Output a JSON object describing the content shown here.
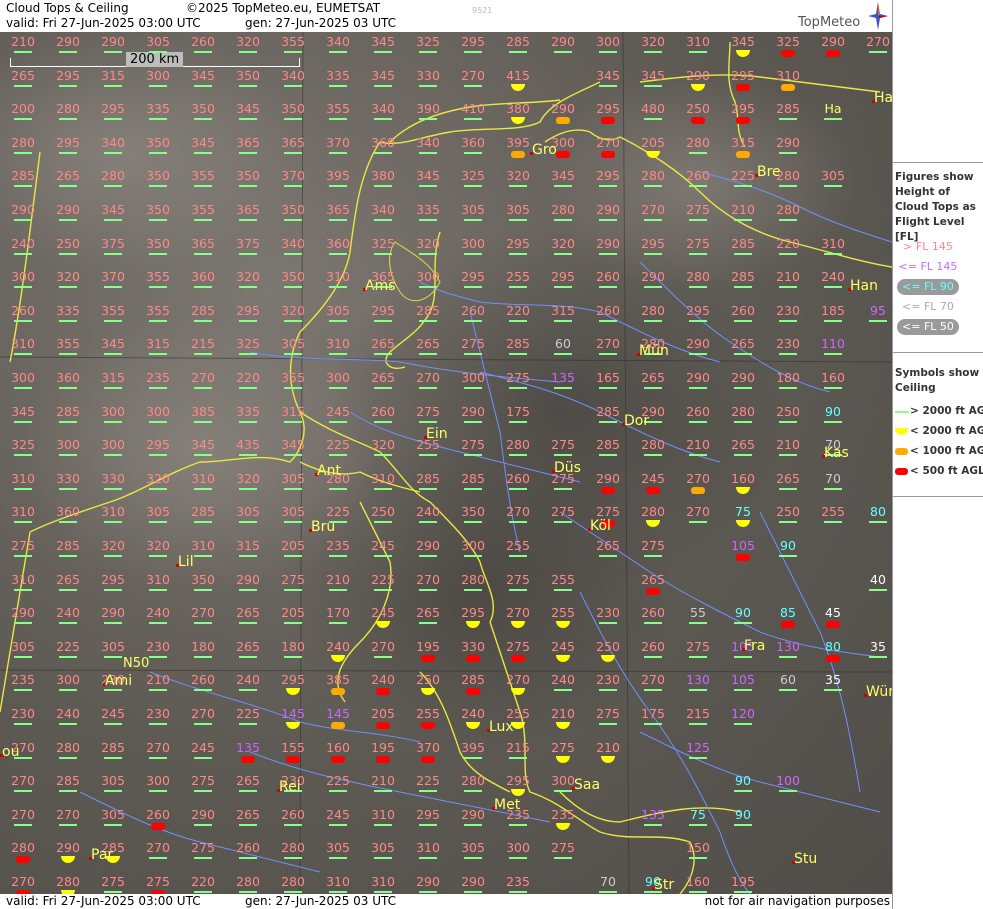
{
  "header": {
    "title": "Cloud Tops & Ceiling",
    "copyright": "©2025 TopMeteo.eu, EUMETSAT",
    "valid": "valid:  Fri  27-Jun-2025  03:00 UTC",
    "gen": "gen: 27-Jun-2025 03 UTC",
    "code": "9521",
    "logo": "TopMeteo"
  },
  "footer": {
    "valid": "valid:  Fri  27-Jun-2025  03:00 UTC",
    "gen": "gen: 27-Jun-2025 03 UTC",
    "note": "not for air navigation purposes"
  },
  "map": {
    "scale_label": "200 km",
    "latitude_label": "N50",
    "cities": [
      {
        "name": "Gro"
      },
      {
        "name": "Bre"
      },
      {
        "name": "Ams"
      },
      {
        "name": "Han"
      },
      {
        "name": "Mün"
      },
      {
        "name": "Dor"
      },
      {
        "name": "Ein"
      },
      {
        "name": "Ant"
      },
      {
        "name": "Düs"
      },
      {
        "name": "Kas"
      },
      {
        "name": "Köl"
      },
      {
        "name": "Bru"
      },
      {
        "name": "Lil"
      },
      {
        "name": "Fra"
      },
      {
        "name": "Ami"
      },
      {
        "name": "Wür"
      },
      {
        "name": "Lux"
      },
      {
        "name": "Rei"
      },
      {
        "name": "Saa"
      },
      {
        "name": "Met"
      },
      {
        "name": "Par"
      },
      {
        "name": "Stu"
      },
      {
        "name": "Str"
      },
      {
        "name": "Ha"
      },
      {
        "name": "ou"
      }
    ],
    "rows": [
      [
        "210",
        "290",
        "290",
        "305",
        "260",
        "320",
        "355",
        "340",
        "345",
        "325",
        "295",
        "285",
        "290",
        "300",
        "320",
        "310",
        "345",
        "325",
        "290",
        "270"
      ],
      [
        "265",
        "295",
        "315",
        "300",
        "345",
        "350",
        "340",
        "335",
        "345",
        "330",
        "270",
        "415",
        "",
        "345",
        "345",
        "290",
        "295",
        "310",
        ""
      ],
      [
        "200",
        "280",
        "295",
        "335",
        "350",
        "345",
        "350",
        "355",
        "340",
        "390",
        "410",
        "380",
        "290",
        "295",
        "480",
        "250",
        "295",
        "285",
        "Ha"
      ],
      [
        "280",
        "295",
        "340",
        "350",
        "345",
        "365",
        "365",
        "370",
        "360",
        "340",
        "360",
        "395",
        "300",
        "270",
        "205",
        "280",
        "315",
        "290",
        ""
      ],
      [
        "285",
        "265",
        "280",
        "350",
        "355",
        "350",
        "370",
        "395",
        "380",
        "345",
        "325",
        "320",
        "345",
        "295",
        "280",
        "260",
        "225",
        "280",
        "305"
      ],
      [
        "290",
        "290",
        "345",
        "350",
        "355",
        "365",
        "350",
        "365",
        "340",
        "335",
        "305",
        "305",
        "280",
        "290",
        "270",
        "275",
        "210",
        "280",
        ""
      ],
      [
        "240",
        "250",
        "375",
        "350",
        "365",
        "375",
        "340",
        "360",
        "325",
        "320",
        "300",
        "295",
        "320",
        "290",
        "295",
        "275",
        "285",
        "220",
        "310"
      ],
      [
        "300",
        "320",
        "370",
        "355",
        "360",
        "320",
        "350",
        "310",
        "365",
        "300",
        "295",
        "255",
        "295",
        "260",
        "290",
        "280",
        "285",
        "210",
        "240"
      ],
      [
        "260",
        "335",
        "355",
        "355",
        "285",
        "295",
        "320",
        "305",
        "295",
        "285",
        "260",
        "220",
        "315",
        "260",
        "280",
        "295",
        "260",
        "230",
        "185",
        "95"
      ],
      [
        "310",
        "355",
        "345",
        "315",
        "215",
        "325",
        "305",
        "310",
        "265",
        "265",
        "275",
        "285",
        "60",
        "270",
        "280",
        "290",
        "265",
        "230",
        "110"
      ],
      [
        "300",
        "360",
        "315",
        "235",
        "270",
        "220",
        "355",
        "300",
        "265",
        "270",
        "300",
        "275",
        "135",
        "165",
        "265",
        "290",
        "290",
        "180",
        "160"
      ],
      [
        "345",
        "285",
        "300",
        "300",
        "385",
        "335",
        "315",
        "245",
        "260",
        "275",
        "290",
        "175",
        "",
        "285",
        "290",
        "260",
        "280",
        "250",
        "90"
      ],
      [
        "325",
        "300",
        "300",
        "295",
        "345",
        "435",
        "345",
        "225",
        "320",
        "255",
        "275",
        "280",
        "275",
        "285",
        "280",
        "210",
        "265",
        "210",
        "70"
      ],
      [
        "310",
        "330",
        "330",
        "320",
        "310",
        "320",
        "305",
        "280",
        "310",
        "285",
        "285",
        "260",
        "275",
        "290",
        "245",
        "270",
        "160",
        "265",
        "70"
      ],
      [
        "310",
        "360",
        "310",
        "305",
        "285",
        "305",
        "305",
        "225",
        "250",
        "240",
        "350",
        "270",
        "275",
        "275",
        "280",
        "270",
        "75",
        "250",
        "255",
        "80"
      ],
      [
        "275",
        "285",
        "320",
        "320",
        "310",
        "315",
        "205",
        "235",
        "245",
        "290",
        "300",
        "255",
        "",
        "265",
        "275",
        "",
        "105",
        "90",
        ""
      ],
      [
        "310",
        "265",
        "295",
        "310",
        "350",
        "290",
        "275",
        "210",
        "225",
        "270",
        "280",
        "275",
        "255",
        "",
        "265",
        "",
        "",
        "",
        "",
        "40"
      ],
      [
        "290",
        "240",
        "290",
        "240",
        "270",
        "265",
        "205",
        "170",
        "245",
        "265",
        "295",
        "270",
        "255",
        "230",
        "260",
        "55",
        "90",
        "85",
        "45"
      ],
      [
        "305",
        "225",
        "305",
        "230",
        "180",
        "265",
        "180",
        "240",
        "270",
        "195",
        "330",
        "275",
        "245",
        "250",
        "260",
        "275",
        "105",
        "130",
        "80",
        "35"
      ],
      [
        "235",
        "300",
        "230",
        "210",
        "260",
        "240",
        "295",
        "385",
        "240",
        "250",
        "285",
        "270",
        "240",
        "230",
        "270",
        "130",
        "105",
        "60",
        "35"
      ],
      [
        "230",
        "240",
        "245",
        "230",
        "270",
        "225",
        "145",
        "145",
        "205",
        "255",
        "240",
        "255",
        "210",
        "275",
        "175",
        "215",
        "120",
        ""
      ],
      [
        "270",
        "280",
        "285",
        "270",
        "245",
        "135",
        "155",
        "160",
        "195",
        "370",
        "395",
        "215",
        "275",
        "210",
        "",
        "125",
        "",
        "",
        ""
      ],
      [
        "270",
        "285",
        "305",
        "300",
        "275",
        "265",
        "230",
        "225",
        "210",
        "225",
        "280",
        "295",
        "300",
        "",
        "",
        "",
        "90",
        "100"
      ],
      [
        "270",
        "270",
        "305",
        "260",
        "290",
        "265",
        "260",
        "245",
        "310",
        "295",
        "290",
        "235",
        "235",
        "",
        "135",
        "75",
        "90"
      ],
      [
        "280",
        "290",
        "285",
        "270",
        "275",
        "260",
        "280",
        "305",
        "305",
        "310",
        "305",
        "300",
        "275",
        "",
        "",
        "150",
        "",
        ""
      ],
      [
        "270",
        "280",
        "275",
        "275",
        "220",
        "280",
        "280",
        "310",
        "310",
        "290",
        "290",
        "235",
        "",
        "70",
        "90",
        "160",
        "195"
      ]
    ]
  },
  "legend_heights": {
    "title": "Figures show Height of Cloud Tops as Flight Level  [FL]",
    "items": [
      {
        "label": "> FL 145",
        "color": "#ff8888"
      },
      {
        "label": "<= FL 145",
        "color": "#cc66ff"
      },
      {
        "label": "<= FL 90",
        "color": "#66ffff"
      },
      {
        "label": "<= FL 70",
        "color": "#aaaaaa"
      },
      {
        "label": "<= FL 50",
        "color": "#ffffff"
      }
    ]
  },
  "legend_ceiling": {
    "title": "Symbols show Ceiling",
    "items": [
      {
        "label": "> 2000 ft AGL",
        "color": "#88ff88"
      },
      {
        "label": "< 2000 ft AGL",
        "color": "#ffff00"
      },
      {
        "label": "< 1000 ft AGL",
        "color": "#ffaa00"
      },
      {
        "label": "< 500 ft AGL",
        "color": "#ff0000"
      }
    ]
  }
}
